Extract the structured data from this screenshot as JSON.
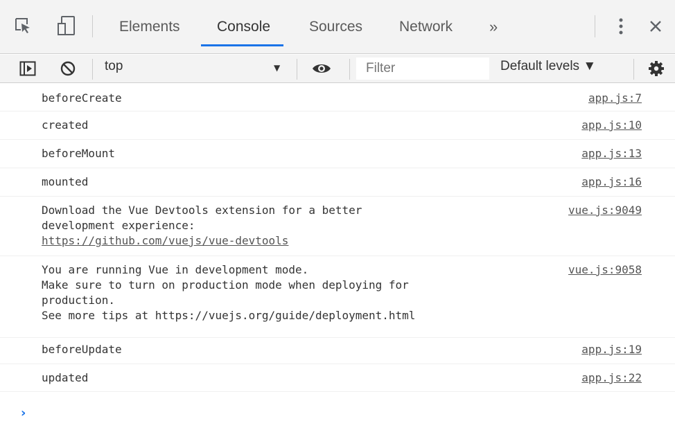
{
  "tabs": [
    "Elements",
    "Console",
    "Sources",
    "Network"
  ],
  "more_tabs": "»",
  "active_tab": "Console",
  "toolbar": {
    "context": "top",
    "filter_placeholder": "Filter",
    "levels": "Default levels ▼"
  },
  "logs": [
    {
      "lines": [
        "beforeCreate"
      ],
      "source": "app.js:7"
    },
    {
      "lines": [
        "created"
      ],
      "source": "app.js:10"
    },
    {
      "lines": [
        "beforeMount"
      ],
      "source": "app.js:13"
    },
    {
      "lines": [
        "mounted"
      ],
      "source": "app.js:16"
    },
    {
      "lines": [
        "Download the Vue Devtools extension for a better",
        "development experience:",
        "https://github.com/vuejs/vue-devtools"
      ],
      "source": "vue.js:9049"
    },
    {
      "lines": [
        "You are running Vue in development mode.",
        "Make sure to turn on production mode when deploying for",
        "production.",
        "See more tips at https://vuejs.org/guide/deployment.html"
      ],
      "source": "vue.js:9058"
    },
    {
      "lines": [
        "beforeUpdate"
      ],
      "source": "app.js:19"
    },
    {
      "lines": [
        "updated"
      ],
      "source": "app.js:22"
    }
  ],
  "prompt": "›",
  "colors": {
    "accent": "#1a73e8",
    "toolbar_bg": "#f3f3f3"
  }
}
